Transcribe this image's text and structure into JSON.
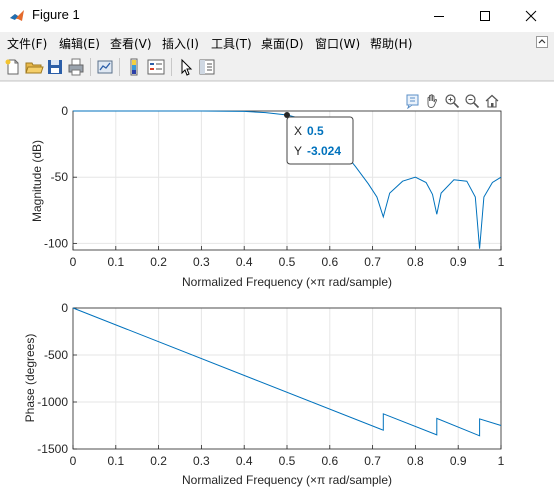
{
  "window": {
    "title": "Figure 1",
    "controls": {
      "minimize": "—",
      "maximize": "☐",
      "close": "✕"
    }
  },
  "menu": {
    "items": [
      {
        "label": "文件(F)"
      },
      {
        "label": "编辑(E)"
      },
      {
        "label": "查看(V)"
      },
      {
        "label": "插入(I)"
      },
      {
        "label": "工具(T)"
      },
      {
        "label": "桌面(D)"
      },
      {
        "label": "窗口(W)"
      },
      {
        "label": "帮助(H)"
      }
    ]
  },
  "toolbar": {
    "icons": [
      "new-figure-icon",
      "open-file-icon",
      "save-icon",
      "print-icon",
      "link-plot-icon",
      "insert-colorbar-icon",
      "insert-legend-icon",
      "edit-plot-icon",
      "property-inspector-icon"
    ]
  },
  "axes_toolbar": {
    "icons": [
      "data-tips-icon",
      "pan-icon",
      "zoom-in-icon",
      "zoom-out-icon",
      "restore-view-icon"
    ]
  },
  "datatip": {
    "x_label": "X",
    "x_value": "0.5",
    "y_label": "Y",
    "y_value": "-3.024",
    "x": 0.5,
    "y": -3.024
  },
  "chart_data": [
    {
      "type": "line",
      "title": "",
      "xlabel": "Normalized Frequency  (×π rad/sample)",
      "ylabel": "Magnitude (dB)",
      "xlim": [
        0,
        1
      ],
      "ylim": [
        -105,
        0
      ],
      "xticks": [
        "0",
        "0.1",
        "0.2",
        "0.3",
        "0.4",
        "0.5",
        "0.6",
        "0.7",
        "0.8",
        "0.9",
        "1"
      ],
      "yticks": [
        "0",
        "-50",
        "-100"
      ],
      "grid": true,
      "color": "#0072bd",
      "series": [
        {
          "x": [
            0,
            0.1,
            0.2,
            0.3,
            0.4,
            0.45,
            0.5,
            0.55,
            0.6,
            0.63,
            0.66,
            0.69,
            0.71,
            0.725,
            0.74,
            0.77,
            0.8,
            0.825,
            0.84,
            0.85,
            0.86,
            0.89,
            0.92,
            0.94,
            0.95,
            0.96,
            0.98,
            1.0
          ],
          "y": [
            0,
            0,
            0,
            0,
            -0.3,
            -1.2,
            -3.0,
            -7,
            -18,
            -30,
            -42,
            -55,
            -65,
            -80,
            -62,
            -53,
            -50,
            -54,
            -63,
            -78,
            -62,
            -52,
            -53,
            -65,
            -104,
            -65,
            -54,
            -50
          ]
        }
      ]
    },
    {
      "type": "line",
      "title": "",
      "xlabel": "Normalized Frequency  (×π rad/sample)",
      "ylabel": "Phase (degrees)",
      "xlim": [
        0,
        1
      ],
      "ylim": [
        -1500,
        0
      ],
      "xticks": [
        "0",
        "0.1",
        "0.2",
        "0.3",
        "0.4",
        "0.5",
        "0.6",
        "0.7",
        "0.8",
        "0.9",
        "1"
      ],
      "yticks": [
        "0",
        "-500",
        "-1000",
        "-1500"
      ],
      "grid": true,
      "color": "#0072bd",
      "series": [
        {
          "x": [
            0,
            0.725,
            0.725,
            0.85,
            0.85,
            0.95,
            0.95,
            1.0
          ],
          "y": [
            0,
            -1300,
            -1125,
            -1350,
            -1175,
            -1360,
            -1180,
            -1250
          ]
        }
      ]
    }
  ]
}
